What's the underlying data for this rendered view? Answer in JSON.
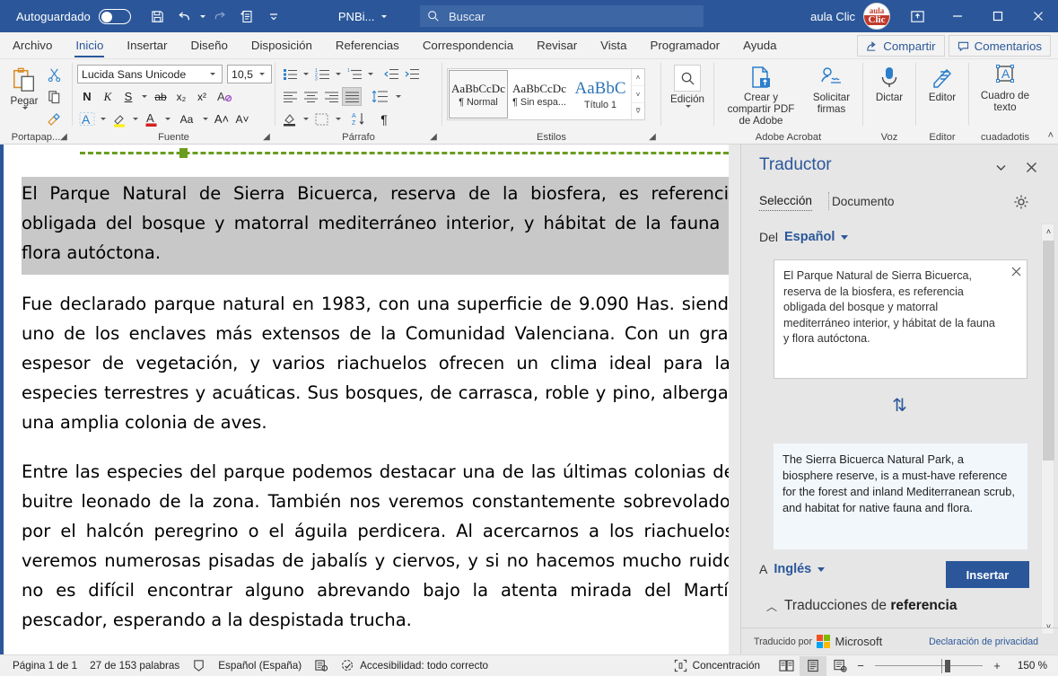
{
  "titlebar": {
    "autosave_label": "Autoguardado",
    "autosave_state": "off",
    "quick_access": [
      {
        "name": "save-icon",
        "label": "Guardar"
      },
      {
        "name": "undo-icon",
        "label": "Deshacer"
      },
      {
        "name": "redo-icon",
        "label": "Rehacer"
      },
      {
        "name": "quick-print-icon",
        "label": "Impresión rápida"
      },
      {
        "name": "customize-qat-icon",
        "label": "Personalizar barra de herramientas de acceso rápido"
      }
    ],
    "document_name": "PNBi...",
    "search_placeholder": "Buscar",
    "search_value": "",
    "account_name": "aula Clic",
    "logo_text_top": "aula",
    "logo_text_bottom": "Clic",
    "ribbon_display_label": "Opciones de presentación de la cinta de opciones",
    "minimize_label": "Minimizar",
    "maximize_label": "Maximizar",
    "close_label": "Cerrar",
    "accent": "#2b579a"
  },
  "tabs": [
    {
      "label": "Archivo",
      "active": false
    },
    {
      "label": "Inicio",
      "active": true
    },
    {
      "label": "Insertar",
      "active": false
    },
    {
      "label": "Diseño",
      "active": false
    },
    {
      "label": "Disposición",
      "active": false
    },
    {
      "label": "Referencias",
      "active": false
    },
    {
      "label": "Correspondencia",
      "active": false
    },
    {
      "label": "Revisar",
      "active": false
    },
    {
      "label": "Vista",
      "active": false
    },
    {
      "label": "Programador",
      "active": false
    },
    {
      "label": "Ayuda",
      "active": false
    }
  ],
  "tabs_right": {
    "share_label": "Compartir",
    "comments_label": "Comentarios"
  },
  "ribbon": {
    "groups": [
      {
        "name": "portapapeles",
        "label": "Portapap...",
        "paste_label": "Pegar",
        "items": [
          "cut-icon",
          "copy-icon",
          "format-painter-icon"
        ]
      },
      {
        "name": "fuente",
        "label": "Fuente",
        "font_name": "Lucida Sans Unicode",
        "font_size": "10,5",
        "row1": [
          "bold-N",
          "italic-K",
          "underline-S",
          "strikethrough-ab",
          "subscript-x2",
          "superscript-x2",
          "clear-format-A"
        ],
        "row2": [
          "text-effects-A",
          "highlight-A",
          "font-color-A",
          "change-case-Aa",
          "grow-font-A",
          "shrink-font-A"
        ]
      },
      {
        "name": "parrafo",
        "label": "Párrafo",
        "row1": [
          "bullets-icon",
          "numbering-icon",
          "multilevel-list-icon",
          "decrease-indent-icon",
          "increase-indent-icon"
        ],
        "row2": [
          "align-left-icon",
          "align-center-icon",
          "align-right-icon",
          "align-justify-icon",
          "line-spacing-icon"
        ],
        "row3": [
          "shading-icon",
          "borders-icon",
          "sort-icon",
          "show-marks-icon"
        ]
      },
      {
        "name": "estilos",
        "label": "Estilos",
        "cards": [
          {
            "preview": "AaBbCcDc",
            "name": "¶ Normal",
            "selected": true
          },
          {
            "preview": "AaBbCcDc",
            "name": "¶ Sin espa...",
            "selected": false
          },
          {
            "preview": "AaBbC",
            "name": "Título 1",
            "selected": false
          }
        ]
      },
      {
        "name": "edicion",
        "label": "",
        "button_label": "Edición"
      },
      {
        "name": "adobe-acrobat",
        "label": "Adobe Acrobat",
        "buttons": [
          {
            "label": "Crear y compartir PDF de Adobe",
            "icon": "create-pdf-icon"
          },
          {
            "label": "Solicitar firmas",
            "icon": "request-signatures-icon"
          }
        ]
      },
      {
        "name": "voz",
        "label": "Voz",
        "buttons": [
          {
            "label": "Dictar",
            "icon": "microphone-icon"
          }
        ]
      },
      {
        "name": "editor",
        "label": "Editor",
        "buttons": [
          {
            "label": "Editor",
            "icon": "editor-pen-icon"
          }
        ]
      },
      {
        "name": "cuadadotis",
        "label": "cuadadotis",
        "buttons": [
          {
            "label": "Cuadro de texto",
            "icon": "text-box-icon"
          }
        ]
      }
    ]
  },
  "document": {
    "paragraphs": [
      {
        "text": "El Parque Natural de Sierra Bicuerca, reserva de la biosfera, es referencia obligada del bosque y matorral mediterráneo interior, y hábitat de la fauna y flora autóctona.",
        "selected": true
      },
      {
        "text": "Fue declarado parque natural en 1983, con una superficie de 9.090 Has. siendo uno de los enclaves más extensos de la Comunidad Valenciana. Con un gran espesor de vegetación, y varios riachuelos ofrecen un clima ideal para las especies terrestres y acuáticas. Sus bosques, de carrasca, roble y pino, albergan una amplia colonia de aves.",
        "selected": false
      },
      {
        "text": "Entre las especies del parque podemos destacar una de las últimas colonias del buitre leonado de la zona. También nos veremos constantemente sobrevolados por el halcón peregrino o el águila perdicera. Al acercarnos a los riachuelos, veremos numerosas pisadas de jabalís y ciervos, y si no hacemos mucho ruido, no es difícil encontrar alguno abrevando bajo la atenta mirada del Martín pescador, esperando a la despistada trucha.",
        "selected": false
      }
    ]
  },
  "translator": {
    "title": "Traductor",
    "collapse_label": "Opciones del panel",
    "close_label": "Cerrar",
    "tabs": [
      {
        "label": "Selección",
        "active": true
      },
      {
        "label": "Documento",
        "active": false
      }
    ],
    "settings_label": "Configuración",
    "from_label": "Del",
    "from_language": "Español",
    "source_text": "El Parque Natural de Sierra Bicuerca, reserva de la biosfera, es referencia obligada del bosque y matorral mediterráneo interior, y hábitat de la fauna y flora autóctona.",
    "clear_label": "Borrar texto",
    "swap_label": "Intercambiar idiomas",
    "to_label": "A",
    "to_language": "Inglés",
    "translated_text": "The Sierra Bicuerca Natural Park, a biosphere reserve, is a must-have reference for the forest and inland Mediterranean scrub, and habitat for native fauna and flora.",
    "insert_label": "Insertar",
    "reference_prefix": "Traducciones de ",
    "reference_bold": "referencia",
    "footer_credit": "Traducido por",
    "footer_brand": "Microsoft",
    "footer_privacy": "Declaración de privacidad"
  },
  "statusbar": {
    "page": "Página 1 de 1",
    "words": "27 de 153 palabras",
    "proofing_icon": "proofing-icon",
    "language": "Español (España)",
    "track_changes_icon": "track-changes-icon",
    "accessibility": "Accesibilidad: todo correcto",
    "focus_label": "Concentración",
    "views": [
      {
        "name": "read-mode-icon",
        "active": false
      },
      {
        "name": "print-layout-icon",
        "active": true
      },
      {
        "name": "web-layout-icon",
        "active": false
      }
    ],
    "zoom_out": "−",
    "zoom_in": "+",
    "zoom_level": "150 %"
  }
}
